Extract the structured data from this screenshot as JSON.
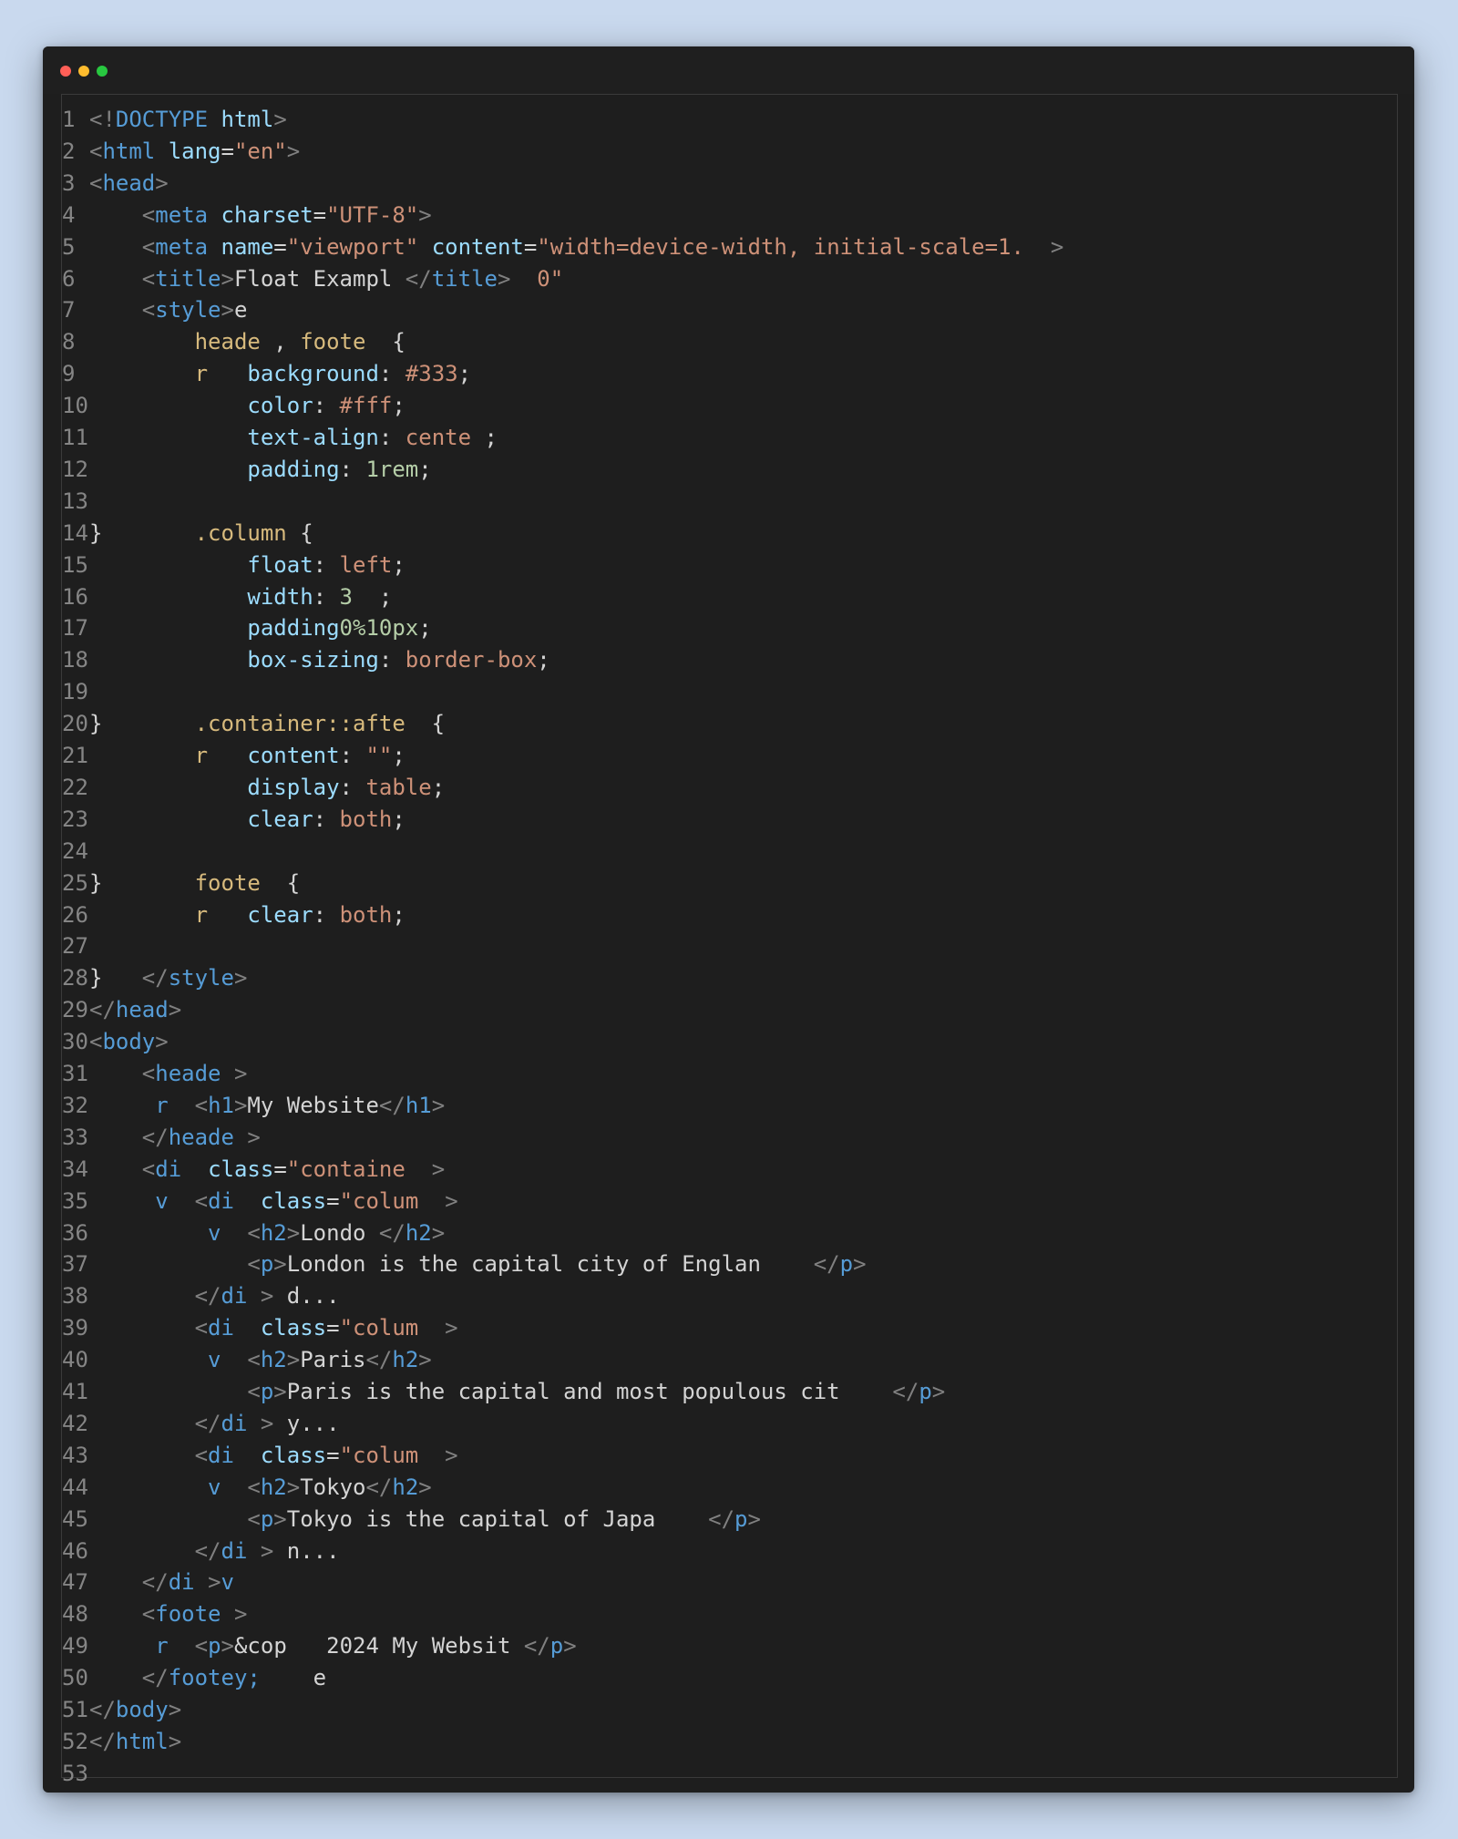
{
  "window": {
    "traffic_lights": {
      "red": "#ff5f57",
      "yellow": "#febc2e",
      "green": "#28c840"
    }
  },
  "lines": [
    {
      "n": "1",
      "tokens": [
        [
          "punc",
          "<!"
        ],
        [
          "tag",
          "DOCTYPE"
        ],
        [
          "txt",
          " "
        ],
        [
          "attr",
          "html"
        ],
        [
          "punc",
          ">"
        ]
      ]
    },
    {
      "n": "2",
      "tokens": [
        [
          "punc",
          "<"
        ],
        [
          "tag",
          "html"
        ],
        [
          "txt",
          " "
        ],
        [
          "attr",
          "lang"
        ],
        [
          "txt",
          "="
        ],
        [
          "str",
          "\"en\""
        ],
        [
          "punc",
          ">"
        ]
      ]
    },
    {
      "n": "3",
      "tokens": [
        [
          "punc",
          "<"
        ],
        [
          "tag",
          "head"
        ],
        [
          "punc",
          ">"
        ]
      ]
    },
    {
      "n": "4",
      "tokens": [
        [
          "txt",
          "    "
        ],
        [
          "punc",
          "<"
        ],
        [
          "tag",
          "meta"
        ],
        [
          "txt",
          " "
        ],
        [
          "attr",
          "charset"
        ],
        [
          "txt",
          "="
        ],
        [
          "str",
          "\"UTF-8\""
        ],
        [
          "punc",
          ">"
        ]
      ]
    },
    {
      "n": "5",
      "tokens": [
        [
          "txt",
          "    "
        ],
        [
          "punc",
          "<"
        ],
        [
          "tag",
          "meta"
        ],
        [
          "txt",
          " "
        ],
        [
          "attr",
          "name"
        ],
        [
          "txt",
          "="
        ],
        [
          "str",
          "\"viewport\""
        ],
        [
          "txt",
          " "
        ],
        [
          "attr",
          "content"
        ],
        [
          "txt",
          "="
        ],
        [
          "str",
          "\"width=device-width, initial-scale=1.  "
        ],
        [
          "punc",
          ">"
        ]
      ]
    },
    {
      "n": "6",
      "tokens": [
        [
          "txt",
          "    "
        ],
        [
          "punc",
          "<"
        ],
        [
          "tag",
          "title"
        ],
        [
          "punc",
          ">"
        ],
        [
          "txt",
          "Float Exampl "
        ],
        [
          "punc",
          "</"
        ],
        [
          "tag",
          "title"
        ],
        [
          "punc",
          ">"
        ],
        [
          "str",
          "  0\""
        ]
      ]
    },
    {
      "n": "7",
      "tokens": [
        [
          "txt",
          "    "
        ],
        [
          "punc",
          "<"
        ],
        [
          "tag",
          "style"
        ],
        [
          "punc",
          ">"
        ],
        [
          "txt",
          "e"
        ]
      ]
    },
    {
      "n": "8",
      "tokens": [
        [
          "txt",
          "        "
        ],
        [
          "sel",
          "heade"
        ],
        [
          "txt",
          " , "
        ],
        [
          "sel",
          "foote"
        ],
        [
          "txt",
          "  {"
        ]
      ]
    },
    {
      "n": "9",
      "tokens": [
        [
          "txt",
          "        "
        ],
        [
          "sel",
          "r"
        ],
        [
          "txt",
          "   "
        ],
        [
          "attr",
          "background"
        ],
        [
          "txt",
          ": "
        ],
        [
          "str",
          "#333"
        ],
        [
          "txt",
          ";"
        ]
      ]
    },
    {
      "n": "10",
      "tokens": [
        [
          "txt",
          "            "
        ],
        [
          "attr",
          "color"
        ],
        [
          "txt",
          ": "
        ],
        [
          "str",
          "#fff"
        ],
        [
          "txt",
          ";"
        ]
      ]
    },
    {
      "n": "11",
      "tokens": [
        [
          "txt",
          "            "
        ],
        [
          "attr",
          "text-align"
        ],
        [
          "txt",
          ": "
        ],
        [
          "str",
          "cente"
        ],
        [
          "txt",
          " ;"
        ]
      ]
    },
    {
      "n": "12",
      "tokens": [
        [
          "txt",
          "            "
        ],
        [
          "attr",
          "padding"
        ],
        [
          "txt",
          ": "
        ],
        [
          "num",
          "1rem"
        ],
        [
          "txt",
          ";"
        ]
      ]
    },
    {
      "n": "13",
      "tokens": []
    },
    {
      "n": "14",
      "tokens": [
        [
          "txt",
          "}       "
        ],
        [
          "sel",
          ".column"
        ],
        [
          "txt",
          " {"
        ]
      ]
    },
    {
      "n": "15",
      "tokens": [
        [
          "txt",
          "            "
        ],
        [
          "attr",
          "float"
        ],
        [
          "txt",
          ": "
        ],
        [
          "str",
          "left"
        ],
        [
          "txt",
          ";"
        ]
      ]
    },
    {
      "n": "16",
      "tokens": [
        [
          "txt",
          "            "
        ],
        [
          "attr",
          "width"
        ],
        [
          "txt",
          ": "
        ],
        [
          "num",
          "3"
        ],
        [
          "txt",
          "  ;"
        ]
      ]
    },
    {
      "n": "17",
      "tokens": [
        [
          "txt",
          "            "
        ],
        [
          "attr",
          "padding"
        ],
        [
          "num",
          "0%10px"
        ],
        [
          "txt",
          ";"
        ]
      ]
    },
    {
      "n": "18",
      "tokens": [
        [
          "txt",
          "            "
        ],
        [
          "attr",
          "box-sizing"
        ],
        [
          "txt",
          ": "
        ],
        [
          "str",
          "border-box"
        ],
        [
          "txt",
          ";"
        ]
      ]
    },
    {
      "n": "19",
      "tokens": []
    },
    {
      "n": "20",
      "tokens": [
        [
          "txt",
          "}       "
        ],
        [
          "sel",
          ".container::afte"
        ],
        [
          "txt",
          "  {"
        ]
      ]
    },
    {
      "n": "21",
      "tokens": [
        [
          "txt",
          "        "
        ],
        [
          "sel",
          "r"
        ],
        [
          "txt",
          "   "
        ],
        [
          "attr",
          "content"
        ],
        [
          "txt",
          ": "
        ],
        [
          "str",
          "\"\""
        ],
        [
          "txt",
          ";"
        ]
      ]
    },
    {
      "n": "22",
      "tokens": [
        [
          "txt",
          "            "
        ],
        [
          "attr",
          "display"
        ],
        [
          "txt",
          ": "
        ],
        [
          "str",
          "table"
        ],
        [
          "txt",
          ";"
        ]
      ]
    },
    {
      "n": "23",
      "tokens": [
        [
          "txt",
          "            "
        ],
        [
          "attr",
          "clear"
        ],
        [
          "txt",
          ": "
        ],
        [
          "str",
          "both"
        ],
        [
          "txt",
          ";"
        ]
      ]
    },
    {
      "n": "24",
      "tokens": []
    },
    {
      "n": "25",
      "tokens": [
        [
          "txt",
          "}       "
        ],
        [
          "sel",
          "foote"
        ],
        [
          "txt",
          "  {"
        ]
      ]
    },
    {
      "n": "26",
      "tokens": [
        [
          "txt",
          "        "
        ],
        [
          "sel",
          "r"
        ],
        [
          "txt",
          "   "
        ],
        [
          "attr",
          "clear"
        ],
        [
          "txt",
          ": "
        ],
        [
          "str",
          "both"
        ],
        [
          "txt",
          ";"
        ]
      ]
    },
    {
      "n": "27",
      "tokens": []
    },
    {
      "n": "28",
      "tokens": [
        [
          "txt",
          "}   "
        ],
        [
          "punc",
          "</"
        ],
        [
          "tag",
          "style"
        ],
        [
          "punc",
          ">"
        ]
      ]
    },
    {
      "n": "29",
      "tokens": [
        [
          "punc",
          "</"
        ],
        [
          "tag",
          "head"
        ],
        [
          "punc",
          ">"
        ]
      ]
    },
    {
      "n": "30",
      "tokens": [
        [
          "punc",
          "<"
        ],
        [
          "tag",
          "body"
        ],
        [
          "punc",
          ">"
        ]
      ]
    },
    {
      "n": "31",
      "tokens": [
        [
          "txt",
          "    "
        ],
        [
          "punc",
          "<"
        ],
        [
          "tag",
          "heade"
        ],
        [
          "txt",
          " "
        ],
        [
          "punc",
          ">"
        ]
      ]
    },
    {
      "n": "32",
      "tokens": [
        [
          "txt",
          "     "
        ],
        [
          "tag",
          "r"
        ],
        [
          "txt",
          "  "
        ],
        [
          "punc",
          "<"
        ],
        [
          "tag",
          "h1"
        ],
        [
          "punc",
          ">"
        ],
        [
          "txt",
          "My Website"
        ],
        [
          "punc",
          "</"
        ],
        [
          "tag",
          "h1"
        ],
        [
          "punc",
          ">"
        ]
      ]
    },
    {
      "n": "33",
      "tokens": [
        [
          "txt",
          "    "
        ],
        [
          "punc",
          "</"
        ],
        [
          "tag",
          "heade"
        ],
        [
          "txt",
          " "
        ],
        [
          "punc",
          ">"
        ]
      ]
    },
    {
      "n": "34",
      "tokens": [
        [
          "txt",
          "    "
        ],
        [
          "punc",
          "<"
        ],
        [
          "tag",
          "di"
        ],
        [
          "txt",
          "  "
        ],
        [
          "attr",
          "class"
        ],
        [
          "txt",
          "="
        ],
        [
          "str",
          "\"containe"
        ],
        [
          "txt",
          "  "
        ],
        [
          "punc",
          ">"
        ]
      ]
    },
    {
      "n": "35",
      "tokens": [
        [
          "txt",
          "     "
        ],
        [
          "tag",
          "v"
        ],
        [
          "txt",
          "  "
        ],
        [
          "punc",
          "<"
        ],
        [
          "tag",
          "di"
        ],
        [
          "txt",
          "  "
        ],
        [
          "attr",
          "class"
        ],
        [
          "txt",
          "="
        ],
        [
          "str",
          "\"colum"
        ],
        [
          "txt",
          "  "
        ],
        [
          "punc",
          ">"
        ]
      ]
    },
    {
      "n": "36",
      "tokens": [
        [
          "txt",
          "         "
        ],
        [
          "tag",
          "v"
        ],
        [
          "txt",
          "  "
        ],
        [
          "punc",
          "<"
        ],
        [
          "tag",
          "h2"
        ],
        [
          "punc",
          ">"
        ],
        [
          "txt",
          "Londo "
        ],
        [
          "punc",
          "</"
        ],
        [
          "tag",
          "h2"
        ],
        [
          "punc",
          ">"
        ]
      ]
    },
    {
      "n": "37",
      "tokens": [
        [
          "txt",
          "            "
        ],
        [
          "punc",
          "<"
        ],
        [
          "tag",
          "p"
        ],
        [
          "punc",
          ">"
        ],
        [
          "txt",
          "London is the capital city of Englan    "
        ],
        [
          "punc",
          "</"
        ],
        [
          "tag",
          "p"
        ],
        [
          "punc",
          ">"
        ]
      ]
    },
    {
      "n": "38",
      "tokens": [
        [
          "txt",
          "        "
        ],
        [
          "punc",
          "</"
        ],
        [
          "tag",
          "di"
        ],
        [
          "txt",
          " "
        ],
        [
          "punc",
          ">"
        ],
        [
          "txt",
          " d..."
        ]
      ]
    },
    {
      "n": "39",
      "tokens": [
        [
          "txt",
          "        "
        ],
        [
          "punc",
          "<"
        ],
        [
          "tag",
          "di"
        ],
        [
          "txt",
          "  "
        ],
        [
          "attr",
          "class"
        ],
        [
          "txt",
          "="
        ],
        [
          "str",
          "\"colum"
        ],
        [
          "txt",
          "  "
        ],
        [
          "punc",
          ">"
        ]
      ]
    },
    {
      "n": "40",
      "tokens": [
        [
          "txt",
          "         "
        ],
        [
          "tag",
          "v"
        ],
        [
          "txt",
          "  "
        ],
        [
          "punc",
          "<"
        ],
        [
          "tag",
          "h2"
        ],
        [
          "punc",
          ">"
        ],
        [
          "txt",
          "Paris"
        ],
        [
          "punc",
          "</"
        ],
        [
          "tag",
          "h2"
        ],
        [
          "punc",
          ">"
        ]
      ]
    },
    {
      "n": "41",
      "tokens": [
        [
          "txt",
          "            "
        ],
        [
          "punc",
          "<"
        ],
        [
          "tag",
          "p"
        ],
        [
          "punc",
          ">"
        ],
        [
          "txt",
          "Paris is the capital and most populous cit    "
        ],
        [
          "punc",
          "</"
        ],
        [
          "tag",
          "p"
        ],
        [
          "punc",
          ">"
        ]
      ]
    },
    {
      "n": "42",
      "tokens": [
        [
          "txt",
          "        "
        ],
        [
          "punc",
          "</"
        ],
        [
          "tag",
          "di"
        ],
        [
          "txt",
          " "
        ],
        [
          "punc",
          ">"
        ],
        [
          "txt",
          " y..."
        ]
      ]
    },
    {
      "n": "43",
      "tokens": [
        [
          "txt",
          "        "
        ],
        [
          "punc",
          "<"
        ],
        [
          "tag",
          "di"
        ],
        [
          "txt",
          "  "
        ],
        [
          "attr",
          "class"
        ],
        [
          "txt",
          "="
        ],
        [
          "str",
          "\"colum"
        ],
        [
          "txt",
          "  "
        ],
        [
          "punc",
          ">"
        ]
      ]
    },
    {
      "n": "44",
      "tokens": [
        [
          "txt",
          "         "
        ],
        [
          "tag",
          "v"
        ],
        [
          "txt",
          "  "
        ],
        [
          "punc",
          "<"
        ],
        [
          "tag",
          "h2"
        ],
        [
          "punc",
          ">"
        ],
        [
          "txt",
          "Tokyo"
        ],
        [
          "punc",
          "</"
        ],
        [
          "tag",
          "h2"
        ],
        [
          "punc",
          ">"
        ]
      ]
    },
    {
      "n": "45",
      "tokens": [
        [
          "txt",
          "            "
        ],
        [
          "punc",
          "<"
        ],
        [
          "tag",
          "p"
        ],
        [
          "punc",
          ">"
        ],
        [
          "txt",
          "Tokyo is the capital of Japa    "
        ],
        [
          "punc",
          "</"
        ],
        [
          "tag",
          "p"
        ],
        [
          "punc",
          ">"
        ]
      ]
    },
    {
      "n": "46",
      "tokens": [
        [
          "txt",
          "        "
        ],
        [
          "punc",
          "</"
        ],
        [
          "tag",
          "di"
        ],
        [
          "txt",
          " "
        ],
        [
          "punc",
          ">"
        ],
        [
          "txt",
          " n..."
        ]
      ]
    },
    {
      "n": "47",
      "tokens": [
        [
          "txt",
          "    "
        ],
        [
          "punc",
          "</"
        ],
        [
          "tag",
          "di"
        ],
        [
          "txt",
          " "
        ],
        [
          "punc",
          ">"
        ],
        [
          "tag",
          "v"
        ]
      ]
    },
    {
      "n": "48",
      "tokens": [
        [
          "txt",
          "    "
        ],
        [
          "punc",
          "<"
        ],
        [
          "tag",
          "foote"
        ],
        [
          "txt",
          " "
        ],
        [
          "punc",
          ">"
        ]
      ]
    },
    {
      "n": "49",
      "tokens": [
        [
          "txt",
          "     "
        ],
        [
          "tag",
          "r"
        ],
        [
          "txt",
          "  "
        ],
        [
          "punc",
          "<"
        ],
        [
          "tag",
          "p"
        ],
        [
          "punc",
          ">"
        ],
        [
          "txt",
          "&cop   2024 My Websit "
        ],
        [
          "punc",
          "</"
        ],
        [
          "tag",
          "p"
        ],
        [
          "punc",
          ">"
        ]
      ]
    },
    {
      "n": "50",
      "tokens": [
        [
          "txt",
          "    "
        ],
        [
          "punc",
          "</"
        ],
        [
          "tag",
          "footey;"
        ],
        [
          "txt",
          "    e"
        ]
      ]
    },
    {
      "n": "51",
      "tokens": [
        [
          "punc",
          "</"
        ],
        [
          "tag",
          "body"
        ],
        [
          "punc",
          ">"
        ]
      ]
    },
    {
      "n": "52",
      "tokens": [
        [
          "punc",
          "</"
        ],
        [
          "tag",
          "html"
        ],
        [
          "punc",
          ">"
        ]
      ]
    },
    {
      "n": "53",
      "tokens": []
    }
  ]
}
